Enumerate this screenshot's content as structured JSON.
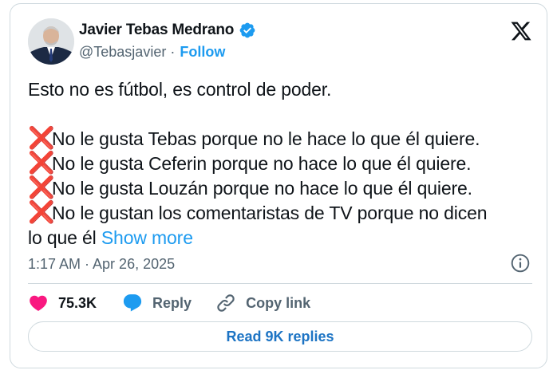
{
  "author": {
    "display_name": "Javier Tebas Medrano",
    "handle": "@Tebasjavier",
    "separator": "·",
    "follow_label": "Follow",
    "verified": true,
    "avatar_icon": "person-portrait"
  },
  "brand": {
    "logo_icon": "x-logo-icon"
  },
  "tweet": {
    "intro": "Esto no es fútbol, es control de poder.",
    "bullet_symbol": "❌",
    "lines": [
      "No le gusta Tebas porque no le hace lo que él quiere.",
      "No le gusta Ceferin porque no hace lo que él quiere.",
      "No le gusta Louzán porque no hace lo que él quiere.",
      "No le gustan los comentaristas de TV porque no dicen"
    ],
    "continuation": "lo que él",
    "show_more_label": "Show more",
    "timestamp": "1:17 AM · Apr 26, 2025"
  },
  "actions": {
    "likes_count": "75.3K",
    "reply_label": "Reply",
    "copy_link_label": "Copy link",
    "read_replies_label": "Read 9K replies"
  },
  "colors": {
    "accent": "#1d9bf0",
    "like": "#f91880",
    "cross": "#dd2e44",
    "muted": "#536471",
    "border": "#cfd9de"
  }
}
